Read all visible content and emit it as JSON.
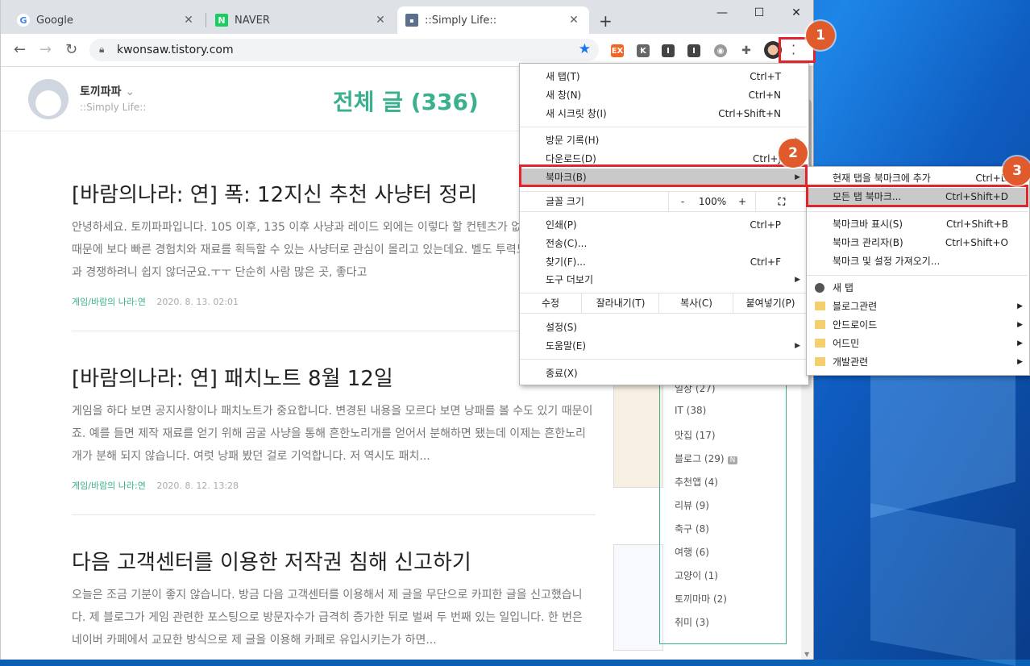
{
  "browser": {
    "tabs": [
      {
        "title": "Google",
        "favicon": "google-icon"
      },
      {
        "title": "NAVER",
        "favicon": "naver-icon"
      },
      {
        "title": "::Simply Life::",
        "favicon": "tistory-icon"
      }
    ],
    "url": "kwonsaw.tistory.com",
    "extensions": [
      "EX",
      "K",
      "I",
      "I"
    ]
  },
  "blog": {
    "name": "토끼파파",
    "subtitle": "::Simply Life::",
    "page_title": "전체 글 (336)"
  },
  "posts": [
    {
      "title": "[바람의나라: 연] 폭: 12지신 추천 사냥터 정리",
      "excerpt": "안녕하세요. 토끼파파입니다. 105 이후, 135 이후 사냥과 레이드 외에는 이렇다 할 컨텐츠가 없는 상황이죠.. 때문에 보다 빠른 경험치와 재료를 획득할 수 있는 사냥터로 관심이 몰리고 있는데요. 벨도 투력도 높은 사람들과 경쟁하려니 쉽지 않더군요.ㅜㅜ 단순히 사람 많은 곳, 좋다고",
      "category": "게임/바람의 나라:연",
      "date": "2020. 8. 13. 02:01"
    },
    {
      "title": "[바람의나라: 연] 패치노트 8월 12일",
      "excerpt": "게임을 하다 보면 공지사항이나 패치노트가 중요합니다. 변경된 내용을 모르다 보면 낭패를 볼 수도 있기 때문이죠. 예를 들면 제작 재료를 얻기 위해 곰굴 사냥을 통해 흔한노리개를 얻어서 분해하면 됐는데 이제는 흔한노리개가 분해 되지 않습니다. 여럿 낭패 봤던 걸로 기억합니다. 저 역시도 패치...",
      "category": "게임/바람의 나라:연",
      "date": "2020. 8. 12. 13:28"
    },
    {
      "title": "다음 고객센터를 이용한 저작권 침해 신고하기",
      "excerpt": "오늘은 조금 기분이 좋지 않습니다. 방금 다음 고객센터를 이용해서 제 글을 무단으로 카피한 글을 신고했습니다. 제 블로그가 게임 관련한 포스팅으로 방문자수가 급격히 증가한 뒤로 벌써 두 번째 있는 일입니다. 한 번은 네이버 카페에서 교묘한 방식으로 제 글을 이용해 카페로 유입시키는가 하면...",
      "category": "",
      "date": ""
    }
  ],
  "categories": [
    {
      "label": "일상 (27)"
    },
    {
      "label": "IT (38)"
    },
    {
      "label": "맛집 (17)"
    },
    {
      "label": "블로그 (29)",
      "badge": "N"
    },
    {
      "label": "추천앱 (4)"
    },
    {
      "label": "리뷰 (9)"
    },
    {
      "label": "축구 (8)"
    },
    {
      "label": "여행 (6)"
    },
    {
      "label": "고양이 (1)"
    },
    {
      "label": "토끼마마 (2)"
    },
    {
      "label": "취미 (3)"
    }
  ],
  "menu": {
    "items_top": [
      {
        "label": "새 탭(T)",
        "shortcut": "Ctrl+T"
      },
      {
        "label": "새 창(N)",
        "shortcut": "Ctrl+N"
      },
      {
        "label": "새 시크릿 창(I)",
        "shortcut": "Ctrl+Shift+N"
      }
    ],
    "history": "방문 기록(H)",
    "downloads": "다운로드(D)",
    "downloads_shortcut": "Ctrl+J",
    "bookmarks": "북마크(B)",
    "zoom_label": "글꼴 크기",
    "zoom_minus": "-",
    "zoom_value": "100%",
    "zoom_plus": "+",
    "print": "인쇄(P)",
    "print_shortcut": "Ctrl+P",
    "cast": "전송(C)...",
    "find": "찾기(F)...",
    "find_shortcut": "Ctrl+F",
    "more_tools": "도구 더보기",
    "edit_label": "수정",
    "cut": "잘라내기(T)",
    "copy": "복사(C)",
    "paste": "붙여넣기(P)",
    "settings": "설정(S)",
    "help": "도움말(E)",
    "exit": "종료(X)"
  },
  "bookmark_submenu": {
    "add_current": "현재 탭을 북마크에 추가",
    "add_current_shortcut": "Ctrl+D",
    "bookmark_all": "모든 탭 북마크...",
    "bookmark_all_shortcut": "Ctrl+Shift+D",
    "show_bar": "북마크바 표시(S)",
    "show_bar_shortcut": "Ctrl+Shift+B",
    "manager": "북마크 관리자(B)",
    "manager_shortcut": "Ctrl+Shift+O",
    "import": "북마크 및 설정 가져오기...",
    "new_tab": "새 탭",
    "folders": [
      "블로그관련",
      "안드로이드",
      "어드민",
      "개발관련"
    ]
  },
  "annotations": [
    "1",
    "2",
    "3"
  ],
  "colors": {
    "highlight": "#e0262c",
    "badge": "#e05a2c",
    "accent": "#3ab08e"
  }
}
